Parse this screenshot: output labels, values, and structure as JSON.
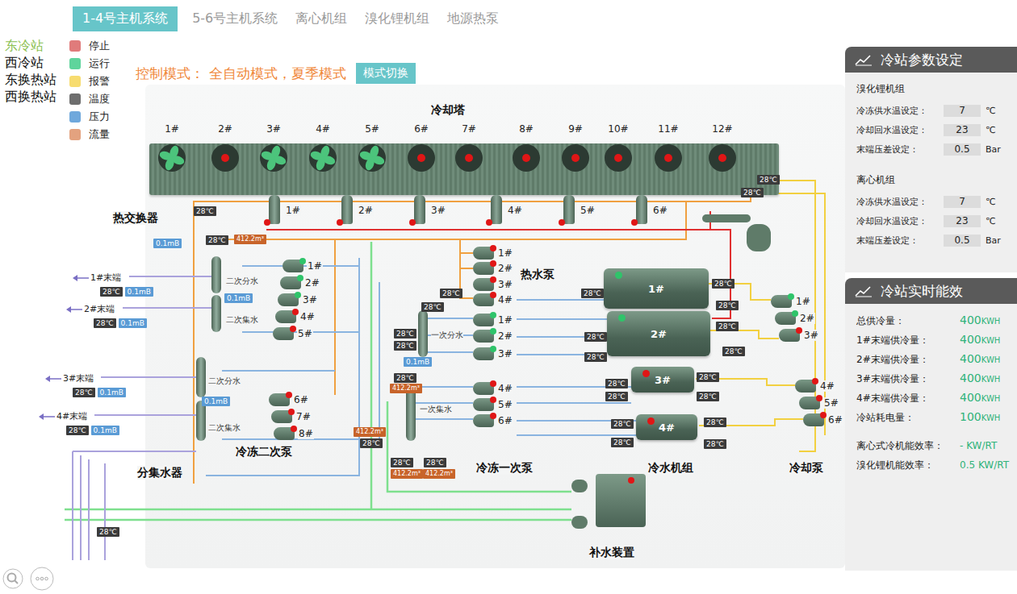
{
  "tabs": [
    {
      "label": "1-4号主机系统",
      "selected": true
    },
    {
      "label": "5-6号主机系统",
      "selected": false
    },
    {
      "label": "离心机组",
      "selected": false
    },
    {
      "label": "溴化锂机组",
      "selected": false
    },
    {
      "label": "地源热泵",
      "selected": false
    }
  ],
  "stations": [
    {
      "label": "东冷站",
      "selected": true
    },
    {
      "label": "西冷站",
      "selected": false
    },
    {
      "label": "东换热站",
      "selected": false
    },
    {
      "label": "西换热站",
      "selected": false
    }
  ],
  "legend": [
    {
      "label": "停止",
      "color": "#e07b7b"
    },
    {
      "label": "运行",
      "color": "#5fd49c"
    },
    {
      "label": "报警",
      "color": "#f7dc6f"
    },
    {
      "label": "温度",
      "color": "#6e6e6e"
    },
    {
      "label": "压力",
      "color": "#6fa8dc"
    },
    {
      "label": "流量",
      "color": "#e3a27f"
    }
  ],
  "mode": {
    "label": "控制模式：",
    "value": "全自动模式，夏季模式",
    "button": "模式切换"
  },
  "diagram": {
    "sectionLabels": [
      "冷却塔",
      "热交换器",
      "热水泵",
      "冷冻二次泵",
      "分集水器",
      "冷冻一次泵",
      "冷水机组",
      "冷却泵",
      "补水装置"
    ],
    "coolingTowers": [
      {
        "label": "1#",
        "running": true
      },
      {
        "label": "2#",
        "running": false
      },
      {
        "label": "3#",
        "running": true
      },
      {
        "label": "4#",
        "running": true
      },
      {
        "label": "5#",
        "running": true
      },
      {
        "label": "6#",
        "running": false
      },
      {
        "label": "7#",
        "running": false
      },
      {
        "label": "8#",
        "running": false
      },
      {
        "label": "9#",
        "running": false
      },
      {
        "label": "10#",
        "running": false
      },
      {
        "label": "11#",
        "running": false
      },
      {
        "label": "12#",
        "running": false
      }
    ],
    "towerValves": [
      {
        "label": "1#",
        "running": false
      },
      {
        "label": "2#",
        "running": false
      },
      {
        "label": "3#",
        "running": false
      },
      {
        "label": "4#",
        "running": false
      },
      {
        "label": "5#",
        "running": false
      },
      {
        "label": "6#",
        "running": false
      }
    ],
    "hotWaterPumps": [
      {
        "label": "1#",
        "running": false
      },
      {
        "label": "2#",
        "running": false
      },
      {
        "label": "3#",
        "running": false
      },
      {
        "label": "4#",
        "running": false
      }
    ],
    "primaryPumps": [
      {
        "label": "1#",
        "running": true
      },
      {
        "label": "2#",
        "running": true
      },
      {
        "label": "3#",
        "running": true
      },
      {
        "label": "4#",
        "running": false
      },
      {
        "label": "5#",
        "running": false
      },
      {
        "label": "6#",
        "running": false
      }
    ],
    "secondaryPumps": [
      {
        "label": "1#",
        "running": true
      },
      {
        "label": "2#",
        "running": true
      },
      {
        "label": "3#",
        "running": true
      },
      {
        "label": "4#",
        "running": false
      },
      {
        "label": "5#",
        "running": false
      },
      {
        "label": "6#",
        "running": false
      },
      {
        "label": "7#",
        "running": false
      },
      {
        "label": "8#",
        "running": false
      }
    ],
    "chillers": [
      {
        "label": "1#",
        "running": true
      },
      {
        "label": "2#",
        "running": true
      },
      {
        "label": "3#",
        "running": false
      },
      {
        "label": "4#",
        "running": false
      }
    ],
    "coolingPumps": [
      {
        "label": "1#",
        "running": true
      },
      {
        "label": "2#",
        "running": true
      },
      {
        "label": "3#",
        "running": false
      },
      {
        "label": "4#",
        "running": false
      },
      {
        "label": "5#",
        "running": false
      },
      {
        "label": "6#",
        "running": false
      }
    ],
    "distributors": [
      "二次分水",
      "二次集水",
      "二次分水",
      "二次集水",
      "一次分水",
      "一次集水"
    ],
    "terminals": [
      {
        "label": "1#末端",
        "temp": "28℃",
        "pressure": "0.1mB"
      },
      {
        "label": "2#末端",
        "temp": "28℃",
        "pressure": "0.1mB"
      },
      {
        "label": "3#末端",
        "temp": "28℃",
        "pressure": "0.1mB"
      },
      {
        "label": "4#末端",
        "temp": "28℃",
        "pressure": "0.1mB"
      }
    ],
    "sensors": [
      {
        "kind": "temp",
        "text": "28℃"
      },
      {
        "kind": "temp",
        "text": "28℃"
      },
      {
        "kind": "temp",
        "text": "28℃"
      },
      {
        "kind": "temp",
        "text": "28℃"
      },
      {
        "kind": "temp",
        "text": "28℃"
      },
      {
        "kind": "temp",
        "text": "28℃"
      },
      {
        "kind": "temp",
        "text": "28℃"
      },
      {
        "kind": "temp",
        "text": "28℃"
      },
      {
        "kind": "temp",
        "text": "28℃"
      },
      {
        "kind": "temp",
        "text": "28℃"
      },
      {
        "kind": "temp",
        "text": "28℃"
      },
      {
        "kind": "temp",
        "text": "28℃"
      },
      {
        "kind": "temp",
        "text": "28℃"
      },
      {
        "kind": "temp",
        "text": "28℃"
      },
      {
        "kind": "temp",
        "text": "28℃"
      },
      {
        "kind": "temp",
        "text": "28℃"
      },
      {
        "kind": "temp",
        "text": "28℃"
      },
      {
        "kind": "temp",
        "text": "28℃"
      },
      {
        "kind": "temp",
        "text": "28℃"
      },
      {
        "kind": "temp",
        "text": "28℃"
      },
      {
        "kind": "temp",
        "text": "28℃"
      },
      {
        "kind": "temp",
        "text": "28℃"
      },
      {
        "kind": "temp",
        "text": "28℃"
      },
      {
        "kind": "temp",
        "text": "28℃"
      },
      {
        "kind": "temp",
        "text": "28℃"
      },
      {
        "kind": "temp",
        "text": "28℃"
      },
      {
        "kind": "temp",
        "text": "28℃"
      },
      {
        "kind": "temp",
        "text": "28℃"
      },
      {
        "kind": "pressure",
        "text": "0.1mB"
      },
      {
        "kind": "pressure",
        "text": "0.1mB"
      },
      {
        "kind": "pressure",
        "text": "0.1mB"
      },
      {
        "kind": "pressure",
        "text": "0.1mB"
      },
      {
        "kind": "flow",
        "text": "412.2m³"
      },
      {
        "kind": "flow",
        "text": "412.2m³"
      },
      {
        "kind": "flow",
        "text": "412.2m³"
      },
      {
        "kind": "flow",
        "text": "412.2m³"
      },
      {
        "kind": "flow",
        "text": "412.2m³"
      }
    ],
    "makeup": {
      "running": false
    }
  },
  "settings": {
    "title": "冷站参数设定",
    "groups": [
      {
        "name": "溴化锂机组",
        "rows": [
          {
            "label": "冷冻供水温设定：",
            "value": "7",
            "unit": "℃"
          },
          {
            "label": "冷却回水温设定：",
            "value": "23",
            "unit": "℃"
          },
          {
            "label": "末端压差设定：",
            "value": "0.5",
            "unit": "Bar"
          }
        ]
      },
      {
        "name": "离心机组",
        "rows": [
          {
            "label": "冷冻供水温设定：",
            "value": "7",
            "unit": "℃"
          },
          {
            "label": "冷却回水温设定：",
            "value": "23",
            "unit": "℃"
          },
          {
            "label": "末端压差设定：",
            "value": "0.5",
            "unit": "Bar"
          }
        ]
      }
    ]
  },
  "efficiency": {
    "title": "冷站实时能效",
    "rows": [
      {
        "label": "总供冷量：",
        "value": "400",
        "unit": "KWH"
      },
      {
        "label": "1#末端供冷量：",
        "value": "400",
        "unit": "KWH"
      },
      {
        "label": "2#末端供冷量：",
        "value": "400",
        "unit": "KWH"
      },
      {
        "label": "3#末端供冷量：",
        "value": "400",
        "unit": "KWH"
      },
      {
        "label": "4#末端供冷量：",
        "value": "400",
        "unit": "KWH"
      },
      {
        "label": "冷站耗电量：",
        "value": "100",
        "unit": "KWH"
      }
    ],
    "ratios": [
      {
        "label": "离心式冷机能效率：",
        "value": "-",
        "unit": "KW/RT"
      },
      {
        "label": "溴化锂机能效率：",
        "value": "0.5",
        "unit": "KW/RT"
      }
    ]
  }
}
